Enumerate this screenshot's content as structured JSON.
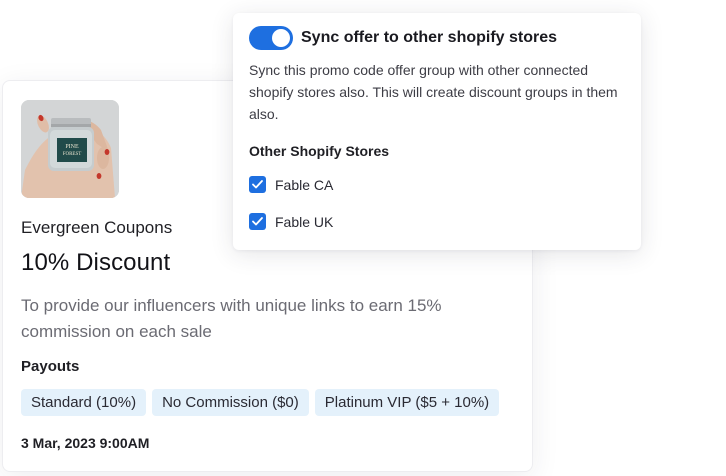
{
  "coupon": {
    "group_name": "Evergreen Coupons",
    "title": "10% Discount",
    "description": "To provide our influencers with unique links to earn 15% commission on each sale",
    "payouts_label": "Payouts",
    "payouts": [
      "Standard (10%)",
      "No Commission ($0)",
      "Platinum VIP ($5 + 10%)"
    ],
    "date": "3 Mar, 2023 9:00AM",
    "image_icon": "candle-jar-product-photo",
    "product_jar_label_line1": "PINE",
    "product_jar_label_line2": "FOREST"
  },
  "sync": {
    "enabled": true,
    "title": "Sync offer to other shopify stores",
    "description": "Sync this promo code offer group with other connected shopify stores also. This will create discount groups in them also.",
    "stores_heading": "Other Shopify Stores",
    "stores": [
      {
        "label": "Fable CA",
        "checked": true
      },
      {
        "label": "Fable UK",
        "checked": true
      }
    ]
  },
  "colors": {
    "accent": "#1e6fe0",
    "tag_bg": "#e4f1fb",
    "muted_text": "#6b6b73"
  }
}
